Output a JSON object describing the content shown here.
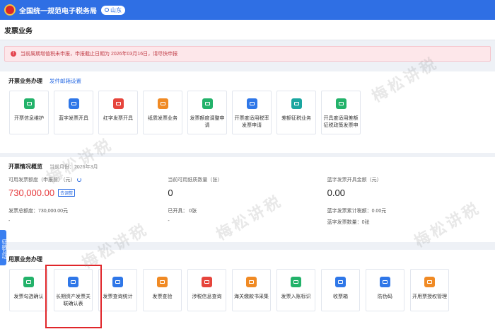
{
  "topbar": {
    "title": "全国统一规范电子税务局",
    "region": "山东"
  },
  "page": {
    "title": "发票业务"
  },
  "alert": {
    "text": "当前属期增值税未申报，申报截止日期为 2026年03月16日，请尽快申报"
  },
  "issue": {
    "title": "开票业务办理",
    "link": "发件邮箱设置",
    "cards": [
      {
        "label": "开票信息维护",
        "icon": "file-edit-icon",
        "color": "#23b26a"
      },
      {
        "label": "蓝字发票开具",
        "icon": "ticket-blue-icon",
        "color": "#2f77e8"
      },
      {
        "label": "红字发票开具",
        "icon": "ticket-red-icon",
        "color": "#e6453c"
      },
      {
        "label": "纸质发票业务",
        "icon": "paper-invoice-icon",
        "color": "#f08a24"
      },
      {
        "label": "发票额度调整申请",
        "icon": "quota-adjust-icon",
        "color": "#23b26a"
      },
      {
        "label": "开票度适用税率发票申请",
        "icon": "tax-rate-icon",
        "color": "#2f77e8"
      },
      {
        "label": "差额征税业务",
        "icon": "diff-tax-icon",
        "color": "#1aa6a0"
      },
      {
        "label": "开具度适用差额征税政策发票申",
        "icon": "diff-policy-icon",
        "color": "#23b26a"
      }
    ]
  },
  "overview": {
    "title": "开票情况概览",
    "period": "当前月份：2026年3月",
    "stats": [
      {
        "label": "可用发票额度（申报前）（元）",
        "value": "730,000.00",
        "badge": "去调整",
        "sub": "发票总额度：730,000.00元",
        "dash": "-"
      },
      {
        "label": "当前可用纸质数量（张）",
        "value": "0",
        "sub": "已开具： 0张",
        "dash": "-"
      },
      {
        "label": "蓝字发票开具金额（元）",
        "value": "0.00",
        "sub": "蓝字发票累计税额：0.00元",
        "dash": "蓝字发票数量：0张"
      }
    ]
  },
  "usage": {
    "title": "用票业务办理",
    "cards": [
      {
        "label": "发票勾选确认",
        "icon": "check-confirm-icon",
        "color": "#23b26a"
      },
      {
        "label": "长期资产发票关联确认表",
        "icon": "long-asset-icon",
        "color": "#2f77e8"
      },
      {
        "label": "发票查询统计",
        "icon": "query-stat-icon",
        "color": "#2f77e8"
      },
      {
        "label": "发票查验",
        "icon": "verify-icon",
        "color": "#f08a24"
      },
      {
        "label": "涉税信息查询",
        "icon": "tax-info-icon",
        "color": "#e6453c"
      },
      {
        "label": "海关缴款书采集",
        "icon": "customs-icon",
        "color": "#f08a24"
      },
      {
        "label": "发票入账标识",
        "icon": "bookkeep-icon",
        "color": "#23b26a"
      },
      {
        "label": "收票箱",
        "icon": "inbox-icon",
        "color": "#2f77e8"
      },
      {
        "label": "防伪码",
        "icon": "qrcode-icon",
        "color": "#2f77e8"
      },
      {
        "label": "开用票授权管理",
        "icon": "auth-manage-icon",
        "color": "#f08a24"
      }
    ]
  },
  "float_tab": {
    "label": "征纳互动"
  },
  "watermark": {
    "text": "梅松讲税"
  }
}
